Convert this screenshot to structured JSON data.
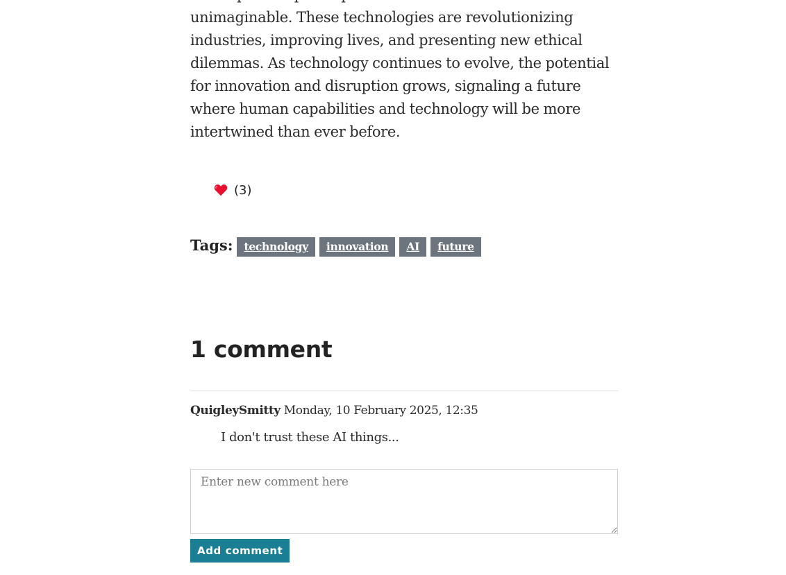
{
  "article": {
    "paragraph": "have opened up new possibilities that were once unimaginable. These technologies are revolutionizing industries, improving lives, and presenting new ethical dilemmas. As technology continues to evolve, the potential for innovation and disruption grows, signaling a future where human capabilities and technology will be more intertwined than ever before."
  },
  "likes": {
    "icon": "heart-icon",
    "count_text": "(3)",
    "heart_color": "#e8102f"
  },
  "tags": {
    "label": "Tags:",
    "items": [
      "technology",
      "innovation",
      "AI",
      "future"
    ],
    "badge_color": "#6c757d"
  },
  "comments": {
    "heading": "1 comment",
    "items": [
      {
        "author": "QuigleySmitty",
        "date": "Monday, 10 February 2025, 12:35",
        "text": "I don't trust these AI things..."
      }
    ],
    "form": {
      "placeholder": "Enter new comment here",
      "value": "",
      "submit_label": "Add comment",
      "submit_color": "#1a7f94"
    }
  }
}
